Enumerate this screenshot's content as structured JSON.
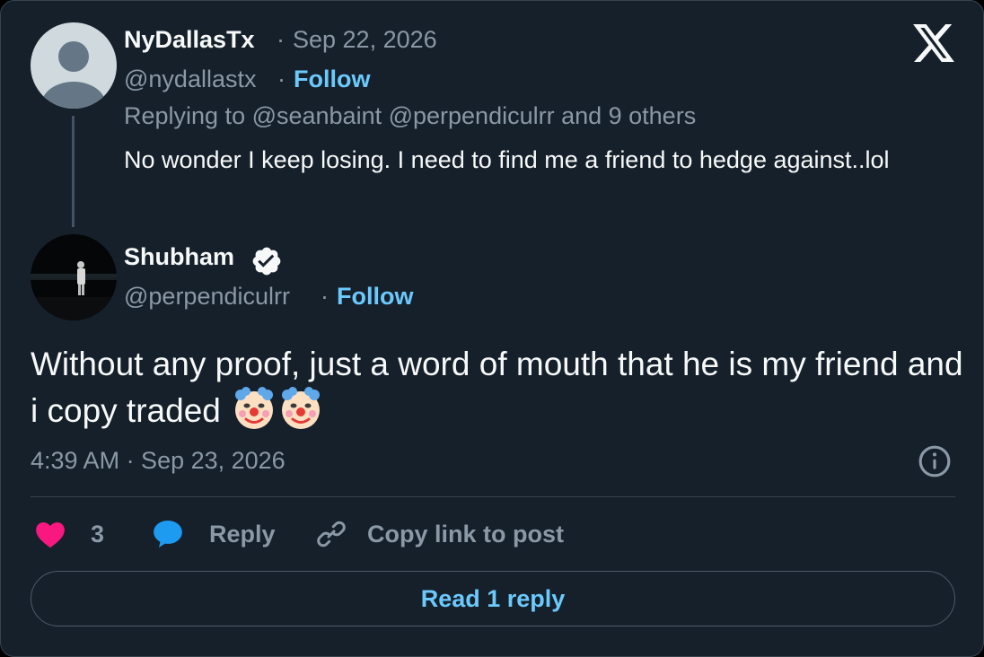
{
  "parent_post": {
    "display_name": "NyDallasTx",
    "date": "Sep 22, 2026",
    "handle": "@nydallastx",
    "follow_label": "Follow",
    "replying_to": "Replying to @seanbaint @perpendiculrr and 9 others",
    "text": "No wonder I keep losing.  I need to find me a friend to hedge against..lol"
  },
  "main_post": {
    "display_name": "Shubham",
    "handle": "@perpendiculrr",
    "follow_label": "Follow",
    "text": "Without any proof, just a word of mouth that he is my friend and i copy traded",
    "emojis": [
      "clown-face",
      "clown-face"
    ],
    "timestamp": "4:39 AM · Sep 23, 2026"
  },
  "actions": {
    "like_count": "3",
    "reply_label": "Reply",
    "copy_link_label": "Copy link to post"
  },
  "read_replies_label": "Read 1 reply",
  "separator": "·",
  "colors": {
    "background": "#15202b",
    "text": "#f7f9f9",
    "muted": "#8b98a5",
    "accent": "#6bc9fb",
    "like": "#f91880",
    "reply": "#1d9bf0",
    "border": "#38444d"
  },
  "icons": [
    "x-logo-icon",
    "verified-badge-icon",
    "info-icon",
    "heart-icon",
    "reply-bubble-icon",
    "link-icon"
  ]
}
